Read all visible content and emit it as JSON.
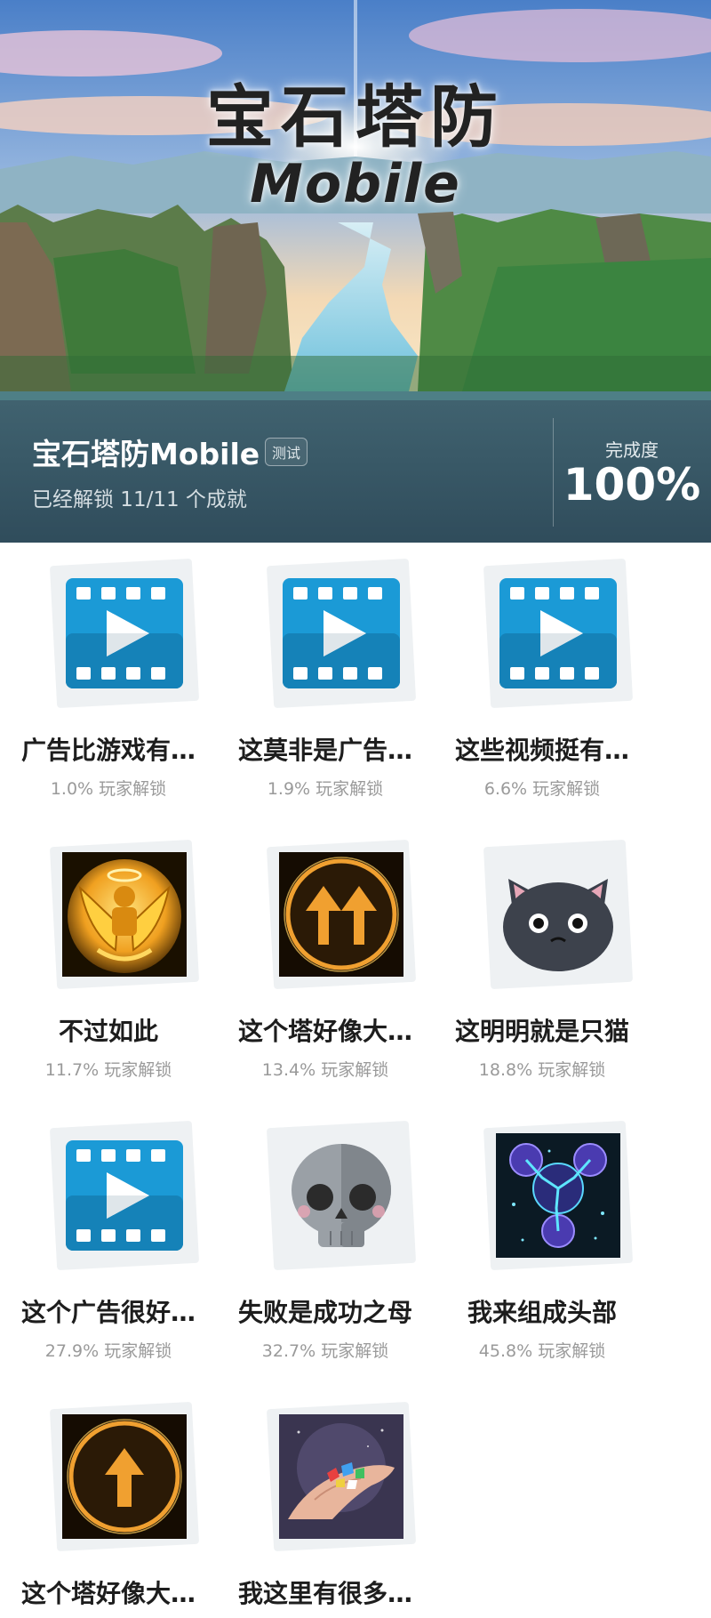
{
  "banner": {
    "title_cn": "宝石塔防",
    "title_en": "Mobile"
  },
  "info": {
    "game_name": "宝石塔防Mobile",
    "badge": "测试",
    "unlock_text": "已经解锁 11/11 个成就",
    "completion_label": "完成度",
    "completion_value": "100%"
  },
  "achievements": [
    {
      "name": "广告比游戏有…",
      "rate": "1.0% 玩家解锁",
      "icon": "video-play-icon"
    },
    {
      "name": "这莫非是广告…",
      "rate": "1.9% 玩家解锁",
      "icon": "video-play-icon"
    },
    {
      "name": "这些视频挺有…",
      "rate": "6.6% 玩家解锁",
      "icon": "video-play-icon"
    },
    {
      "name": "不过如此",
      "rate": "11.7% 玩家解锁",
      "icon": "golden-angel-icon"
    },
    {
      "name": "这个塔好像大…",
      "rate": "13.4% 玩家解锁",
      "icon": "double-up-arrow-icon"
    },
    {
      "name": "这明明就是只猫",
      "rate": "18.8% 玩家解锁",
      "icon": "black-cat-icon"
    },
    {
      "name": "这个广告很好…",
      "rate": "27.9% 玩家解锁",
      "icon": "video-play-icon"
    },
    {
      "name": "失败是成功之母",
      "rate": "32.7% 玩家解锁",
      "icon": "skull-icon"
    },
    {
      "name": "我来组成头部",
      "rate": "45.8% 玩家解锁",
      "icon": "lightning-orbs-icon"
    },
    {
      "name": "这个塔好像大…",
      "rate": "",
      "icon": "single-up-arrow-icon"
    },
    {
      "name": "我这里有很多…",
      "rate": "",
      "icon": "hand-gems-icon"
    }
  ]
}
